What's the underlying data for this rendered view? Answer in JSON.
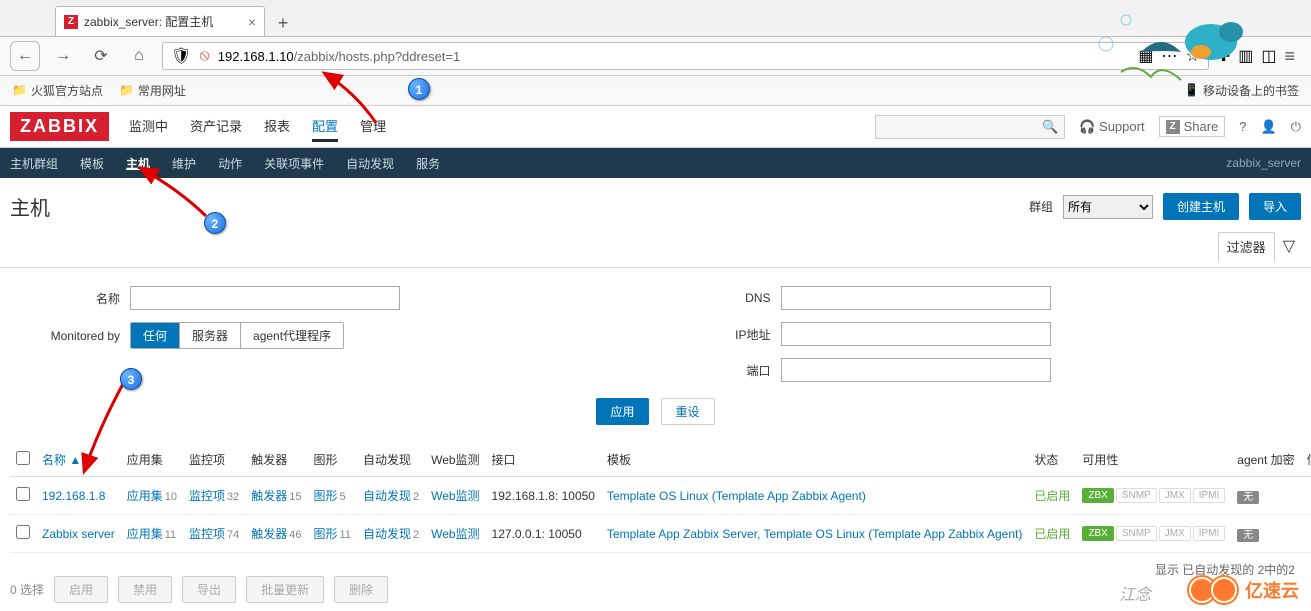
{
  "browser": {
    "tab_title": "zabbix_server: 配置主机",
    "url_host": "192.168.1.10",
    "url_path": "/zabbix/hosts.php?ddreset=1",
    "bookmarks": [
      "火狐官方站点",
      "常用网址"
    ],
    "mobile_bm": "移动设备上的书签"
  },
  "header": {
    "logo": "ZABBIX",
    "nav": [
      "监测中",
      "资产记录",
      "报表",
      "配置",
      "管理"
    ],
    "nav_active": 3,
    "support": "Support",
    "share": "Share"
  },
  "subnav": {
    "items": [
      "主机群组",
      "模板",
      "主机",
      "维护",
      "动作",
      "关联项事件",
      "自动发现",
      "服务"
    ],
    "active": 2,
    "user": "zabbix_server"
  },
  "page": {
    "title": "主机",
    "group_label": "群组",
    "group_value": "所有",
    "btn_create": "创建主机",
    "btn_import": "导入",
    "filter_tab": "过滤器"
  },
  "filter": {
    "name_label": "名称",
    "monitored_label": "Monitored by",
    "seg": [
      "任何",
      "服务器",
      "agent代理程序"
    ],
    "dns_label": "DNS",
    "ip_label": "IP地址",
    "port_label": "端口",
    "btn_apply": "应用",
    "btn_reset": "重设"
  },
  "table": {
    "headers": {
      "name": "名称 ▲",
      "apps": "应用集",
      "items": "监控项",
      "triggers": "触发器",
      "graphs": "图形",
      "discovery": "自动发现",
      "web": "Web监测",
      "iface": "接口",
      "tmpl": "模板",
      "status": "状态",
      "avail": "可用性",
      "enc": "agent 加密",
      "info": "信息"
    },
    "rows": [
      {
        "name": "192.168.1.8",
        "apps": "10",
        "items": "32",
        "triggers": "15",
        "graphs": "5",
        "discovery": "2",
        "web_cnt": "",
        "iface": "192.168.1.8: 10050",
        "tmpl_text": "Template OS Linux",
        "tmpl_sub": "(Template App Zabbix Agent)",
        "status": "已启用",
        "enc": "无"
      },
      {
        "name": "Zabbix server",
        "apps": "11",
        "items": "74",
        "triggers": "46",
        "graphs": "11",
        "discovery": "2",
        "web_cnt": "",
        "iface": "127.0.0.1: 10050",
        "tmpl_text": "Template App Zabbix Server, Template OS Linux",
        "tmpl_sub": "(Template App Zabbix Agent)",
        "status": "已启用",
        "enc": "无"
      }
    ],
    "labels": {
      "apps": "应用集",
      "items": "监控项",
      "triggers": "触发器",
      "graphs": "图形",
      "discovery": "自动发现",
      "web": "Web监测"
    },
    "avail_boxes": [
      "ZBX",
      "SNMP",
      "JMX",
      "IPMI"
    ],
    "footer": "显示 已自动发现的 2中的2"
  },
  "bottom": {
    "selected": "0 选择",
    "btns": [
      "启用",
      "禁用",
      "导出",
      "批量更新",
      "删除"
    ]
  },
  "watermark": {
    "brand": "亿速云",
    "sig": "江念"
  }
}
